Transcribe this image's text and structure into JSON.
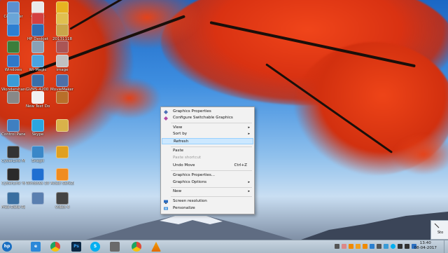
{
  "desktop_icons": [
    {
      "label": "Computer",
      "color": "#5b8fd0"
    },
    {
      "label": "Google",
      "color": "#e9e9e9"
    },
    {
      "label": "",
      "color": "#e7b321"
    },
    {
      "label": "",
      "color": "#6aa5d7"
    },
    {
      "label": "",
      "color": "#d44040"
    },
    {
      "label": "",
      "color": "#e0c050"
    },
    {
      "label": "",
      "color": "#2d7fd1"
    },
    {
      "label": "HP Deskjet",
      "color": "#2f6db5"
    },
    {
      "label": "20131118",
      "color": "#c9a64a"
    },
    {
      "label": "",
      "color": "#3b7d3b"
    },
    {
      "label": "",
      "color": "#8aa0b5"
    },
    {
      "label": "",
      "color": "#a55"
    },
    {
      "label": "Windows",
      "color": "#2f78c9"
    },
    {
      "label": "Wi-Magic",
      "color": "#4aa3df"
    },
    {
      "label": "image",
      "color": "#c0c0c0"
    },
    {
      "label": "Wondershare Filmora",
      "color": "#3a9bd6"
    },
    {
      "label": "GVMS-4200 Client",
      "color": "#3a6ea8"
    },
    {
      "label": "MovieMaker Shortcut",
      "color": "#4e6fa8"
    },
    {
      "label": "",
      "color": "#888"
    },
    {
      "label": "New Text Document",
      "color": "#f0f0f0"
    },
    {
      "label": "",
      "color": "#b86f2a"
    },
    {
      "label": "Control Panel",
      "color": "#3f7fc1"
    },
    {
      "label": "Skype",
      "color": "#2aa5e0"
    },
    {
      "label": "",
      "color": "#d9b24a"
    },
    {
      "label": "CyberLink Media Suite",
      "color": "#333"
    },
    {
      "label": "Snagit",
      "color": "#3a87c8"
    },
    {
      "label": "",
      "color": "#e0a020"
    },
    {
      "label": "CyberLink YouCam",
      "color": "#2a2a2a"
    },
    {
      "label": "Windows 10 Upgrade",
      "color": "#1f6fd1"
    },
    {
      "label": "Avast SafeZone",
      "color": "#f08c20"
    },
    {
      "label": "Free Data Recovery",
      "color": "#3a6fa0"
    },
    {
      "label": "",
      "color": "#5a7fb0"
    },
    {
      "label": "video 4",
      "color": "#444"
    }
  ],
  "context_menu": {
    "items": [
      {
        "label": "Graphics Properties",
        "type": "item",
        "icon": "graphics-icon"
      },
      {
        "label": "Configure Switchable Graphics",
        "type": "item",
        "icon": "switchable-graphics-icon"
      },
      {
        "label": "View",
        "type": "submenu"
      },
      {
        "label": "Sort by",
        "type": "submenu"
      },
      {
        "label": "Refresh",
        "type": "highlighted"
      },
      {
        "label": "Paste",
        "type": "item"
      },
      {
        "label": "Paste shortcut",
        "type": "disabled"
      },
      {
        "label": "Undo Move",
        "type": "item",
        "shortcut": "Ctrl+Z"
      },
      {
        "label": "Graphics Properties...",
        "type": "item"
      },
      {
        "label": "Graphics Options",
        "type": "submenu"
      },
      {
        "label": "New",
        "type": "submenu"
      },
      {
        "label": "Screen resolution",
        "type": "item",
        "icon": "screen-resolution-icon"
      },
      {
        "label": "Personalize",
        "type": "item",
        "icon": "personalize-icon"
      }
    ],
    "arrow": "▸"
  },
  "taskbar": {
    "apps": [
      {
        "name": "hp",
        "label": "hp",
        "color": "#1a6fc2"
      },
      {
        "name": "internet-explorer",
        "label": "e",
        "color": "#2b88d8"
      },
      {
        "name": "chrome",
        "label": "",
        "color": "#dd4b39"
      },
      {
        "name": "photoshop",
        "label": "Ps",
        "color": "#0b2744"
      },
      {
        "name": "skype",
        "label": "S",
        "color": "#00aff0"
      },
      {
        "name": "microphone",
        "label": "",
        "color": "#555"
      },
      {
        "name": "chrome-2",
        "label": "",
        "color": "#dd4b39"
      },
      {
        "name": "vlc",
        "label": "",
        "color": "#f08a00"
      }
    ],
    "clock": {
      "time": "13:40",
      "date": "08-04-2017"
    },
    "tooltip_text": "Sto"
  }
}
